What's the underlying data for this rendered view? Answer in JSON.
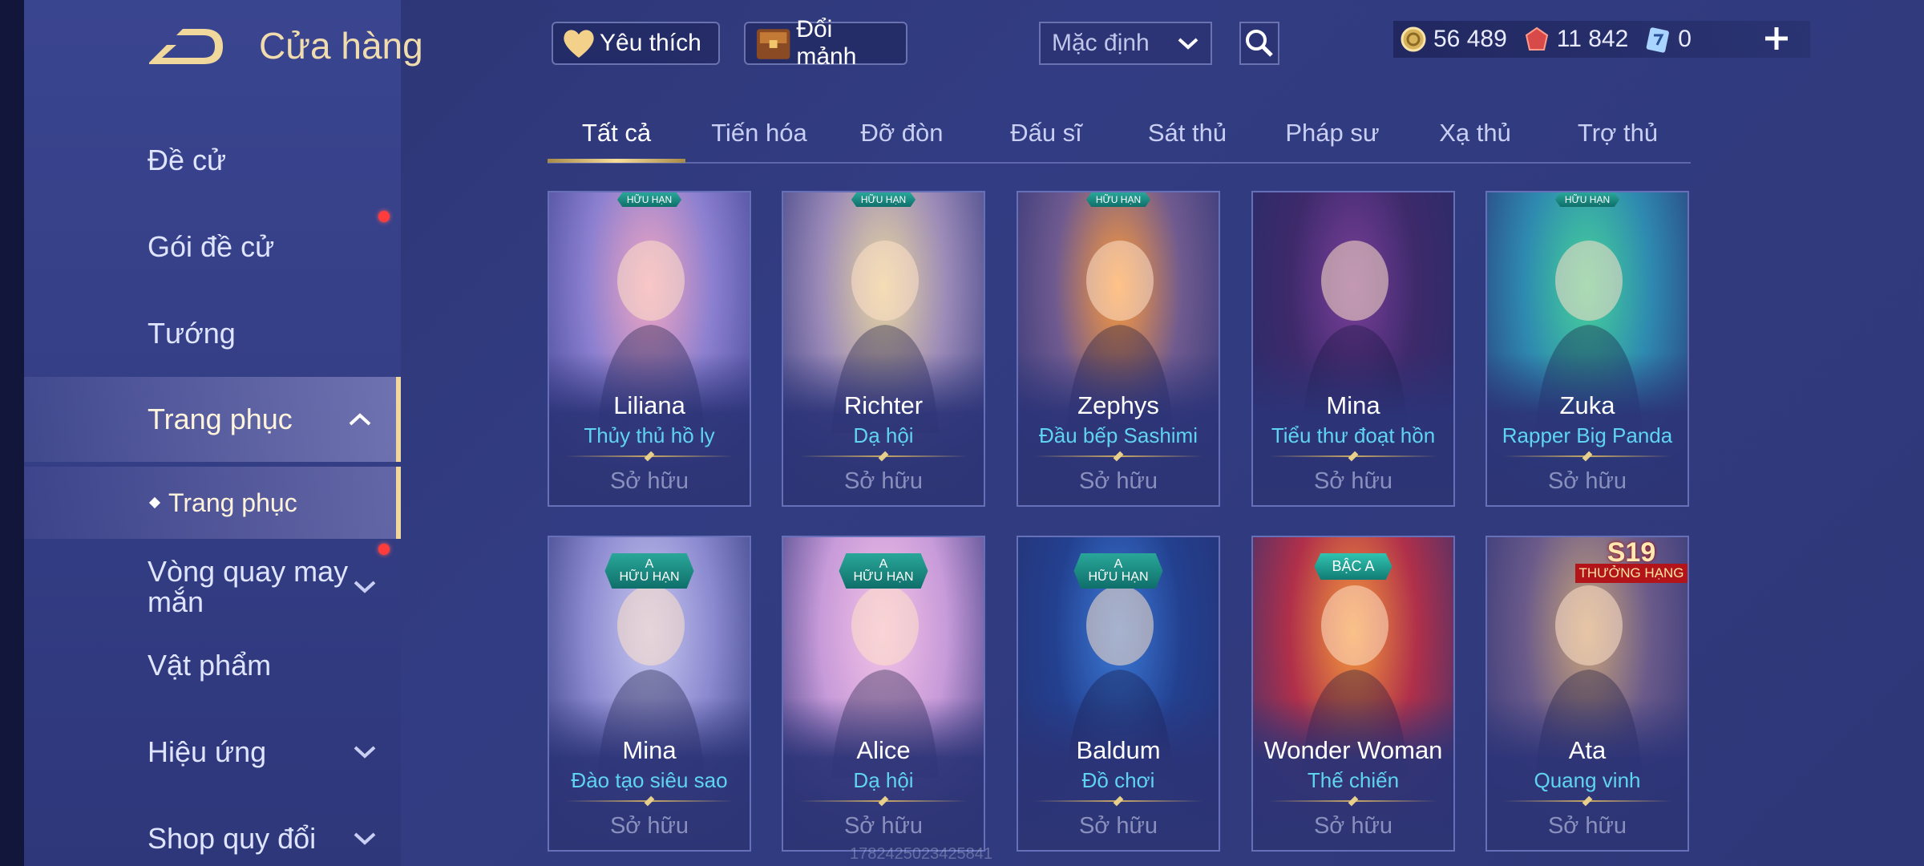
{
  "header": {
    "title": "Cửa hàng",
    "favorites_label": "Yêu thích",
    "exchange_label": "Đổi mảnh",
    "sort_value": "Mặc định"
  },
  "currencies": [
    {
      "icon": "gold-coin-icon",
      "value": "56 489"
    },
    {
      "icon": "ruby-icon",
      "value": "11 842"
    },
    {
      "icon": "voucher-icon",
      "value": "0"
    }
  ],
  "sidebar": {
    "items": [
      {
        "label": "Đề cử"
      },
      {
        "label": "Gói đề cử"
      },
      {
        "label": "Tướng"
      },
      {
        "label": "Trang phục"
      },
      {
        "label": "Trang phục"
      },
      {
        "label": "Vòng quay may\nmắn"
      },
      {
        "label": "Vật phẩm"
      },
      {
        "label": "Hiệu ứng"
      },
      {
        "label": "Shop quy đổi"
      }
    ]
  },
  "tabs": [
    "Tất cả",
    "Tiến hóa",
    "Đỡ đòn",
    "Đấu sĩ",
    "Sát thủ",
    "Pháp sư",
    "Xạ thủ",
    "Trợ thủ"
  ],
  "cards": [
    {
      "hero": "Liliana",
      "skin": "Thủy thủ hồ ly",
      "status": "Sở hữu",
      "badge": "HỮU HẠN",
      "art": [
        "#f2a6c2",
        "#8b7fd0",
        "#3a3f8e"
      ]
    },
    {
      "hero": "Richter",
      "skin": "Dạ hội",
      "status": "Sở hữu",
      "badge": "HỮU HẠN",
      "art": [
        "#e8d6a0",
        "#9b8ab8",
        "#2f367c"
      ]
    },
    {
      "hero": "Zephys",
      "skin": "Đầu bếp Sashimi",
      "status": "Sở hữu",
      "badge": "HỮU HẠN",
      "art": [
        "#ff9c3a",
        "#6f5a8f",
        "#283073"
      ]
    },
    {
      "hero": "Mina",
      "skin": "Tiểu thư đoạt hồn",
      "status": "Sở hữu",
      "badge": "",
      "art": [
        "#7a3f9a",
        "#3d2a6b",
        "#252c6a"
      ]
    },
    {
      "hero": "Zuka",
      "skin": "Rapper Big Panda",
      "status": "Sở hữu",
      "badge": "HỮU HẠN",
      "art": [
        "#46d29a",
        "#2e8ab0",
        "#2a2f74"
      ]
    },
    {
      "hero": "Mina",
      "skin": "Đào tạo siêu sao",
      "status": "Sở hữu",
      "badge": "A\nHỮU HẠN",
      "art": [
        "#c8c8f0",
        "#8c8ad0",
        "#2c3478"
      ]
    },
    {
      "hero": "Alice",
      "skin": "Dạ hội",
      "status": "Sở hữu",
      "badge": "A\nHỮU HẠN",
      "art": [
        "#f3c3e6",
        "#c79ad9",
        "#2f3479"
      ]
    },
    {
      "hero": "Baldum",
      "skin": "Đồ chơi",
      "status": "Sở hữu",
      "badge": "A\nHỮU HẠN",
      "art": [
        "#3b7ad8",
        "#23408f",
        "#263071"
      ]
    },
    {
      "hero": "Wonder Woman",
      "skin": "Thế chiến",
      "status": "Sở hữu",
      "badge": "BẬC A",
      "art": [
        "#f59a3c",
        "#b0304a",
        "#2d3273"
      ]
    },
    {
      "hero": "Ata",
      "skin": "Quang vinh",
      "status": "Sở hữu",
      "badge": "S19 THƯỞNG HẠNG",
      "art": [
        "#c9a47a",
        "#6a5a8a",
        "#2a3174"
      ]
    }
  ],
  "watermark": "1782425023425841",
  "colors": {
    "accent_gold": "#f0d89c",
    "skin_cyan": "#5fd4f0",
    "notify_red": "#ff3c3c"
  }
}
